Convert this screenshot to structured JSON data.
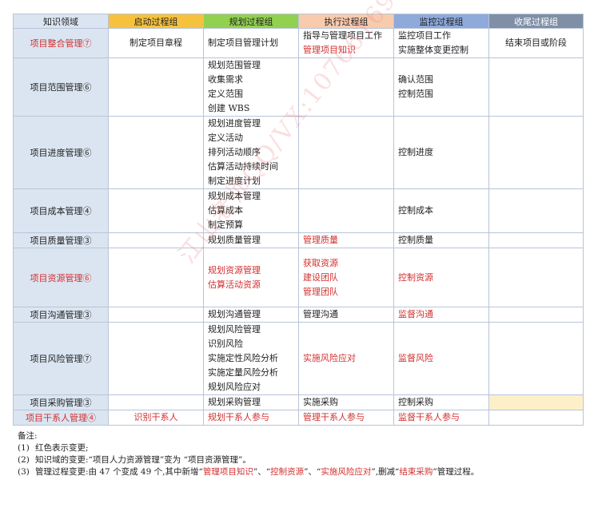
{
  "headers": {
    "knowledge_area": "知识领域",
    "initiating": "启动过程组",
    "planning": "规划过程组",
    "executing": "执行过程组",
    "monitoring": "监控过程组",
    "closing": "收尾过程组"
  },
  "rows": {
    "integration": {
      "area": "项目整合管理⑦",
      "initiating": [
        "制定项目章程"
      ],
      "planning": [
        "制定项目管理计划"
      ],
      "executing": [
        "指导与管理项目工作",
        "管理项目知识"
      ],
      "monitoring": [
        "监控项目工作",
        "实施整体变更控制"
      ],
      "closing": [
        "结束项目或阶段"
      ]
    },
    "scope": {
      "area": "项目范围管理⑥",
      "planning": [
        "规划范围管理",
        "收集需求",
        "定义范围",
        "创建 WBS"
      ],
      "monitoring": [
        "确认范围",
        "控制范围"
      ]
    },
    "schedule": {
      "area": "项目进度管理⑥",
      "planning": [
        "规划进度管理",
        "定义活动",
        "排列活动顺序",
        "估算活动持续时间",
        "制定进度计划"
      ],
      "monitoring": [
        "控制进度"
      ]
    },
    "cost": {
      "area": "项目成本管理④",
      "planning": [
        "规划成本管理",
        "估算成本",
        "制定预算"
      ],
      "monitoring": [
        "控制成本"
      ]
    },
    "quality": {
      "area": "项目质量管理③",
      "planning": [
        "规划质量管理"
      ],
      "executing": [
        "管理质量"
      ],
      "monitoring": [
        "控制质量"
      ]
    },
    "resource": {
      "area": "项目资源管理⑥",
      "planning": [
        "规划资源管理",
        "估算活动资源"
      ],
      "executing": [
        "获取资源",
        "建设团队",
        "管理团队"
      ],
      "monitoring": [
        "控制资源"
      ]
    },
    "communication": {
      "area": "项目沟通管理③",
      "planning": [
        "规划沟通管理"
      ],
      "executing": [
        "管理沟通"
      ],
      "monitoring": [
        "监督沟通"
      ]
    },
    "risk": {
      "area": "项目风险管理⑦",
      "planning": [
        "规划风险管理",
        "识别风险",
        "实施定性风险分析",
        "实施定量风险分析",
        "规划风险应对"
      ],
      "executing": [
        "实施风险应对"
      ],
      "monitoring": [
        "监督风险"
      ]
    },
    "procurement": {
      "area": "项目采购管理③",
      "planning": [
        "规划采购管理"
      ],
      "executing": [
        "实施采购"
      ],
      "monitoring": [
        "控制采购"
      ]
    },
    "stakeholder": {
      "area": "项目干系人管理④",
      "initiating": [
        "识别干系人"
      ],
      "planning": [
        "规划干系人参与"
      ],
      "executing": [
        "管理干系人参与"
      ],
      "monitoring": [
        "监督干系人参与"
      ]
    }
  },
  "notes": {
    "title": "备注:",
    "items": [
      {
        "num": "(1)",
        "text": "红色表示变更;"
      },
      {
        "num": "(2)",
        "text": "知识域的变更:“项目人力资源管理”变为 “项目资源管理”。"
      },
      {
        "num": "(3)",
        "parts": [
          "管理过程变更:由 47 个变成 49 个,其中新增“",
          "管理项目知识",
          "”、“",
          "控制资源",
          "”、“",
          "实施风险应对",
          "”,删减“",
          "结束采购",
          "”管理过程。"
        ]
      }
    ]
  },
  "watermark": "江山老师QQ/VX:1076616931",
  "colors": {
    "change_red": "#d22f2f",
    "area_bg": "#dbe5f1",
    "initiating_bg": "#f6c23e",
    "planning_bg": "#92d050",
    "executing_bg": "#f8cbad",
    "monitoring_bg": "#8eaadb",
    "closing_bg": "#7f8fa6",
    "removed_bg": "#fdf0c9"
  }
}
